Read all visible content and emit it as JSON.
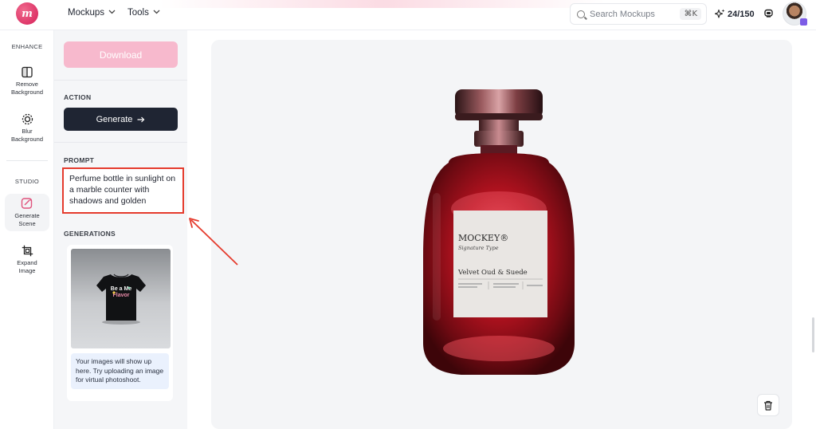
{
  "topbar": {
    "logo_text": "m",
    "menus": [
      {
        "label": "Mockups",
        "icon": "chevron-down-icon"
      },
      {
        "label": "Tools",
        "icon": "chevron-down-icon"
      }
    ],
    "search": {
      "placeholder": "Search Mockups",
      "shortcut": "⌘K"
    },
    "credits": "24/150"
  },
  "rail": {
    "sections": [
      "ENHANCE",
      "STUDIO"
    ],
    "items": [
      {
        "label": "Remove\nBackground",
        "icon": "remove-background-icon",
        "active": false
      },
      {
        "label": "Blur\nBackground",
        "icon": "blur-background-icon",
        "active": false
      },
      {
        "label": "Generate\nScene",
        "icon": "generate-scene-icon",
        "active": true
      },
      {
        "label": "Expand\nImage",
        "icon": "expand-image-icon",
        "active": false
      }
    ]
  },
  "panel": {
    "download_label": "Download",
    "action_label": "ACTION",
    "generate_label": "Generate",
    "prompt_label": "PROMPT",
    "prompt_text": "Perfume bottle in sunlight on a marble counter with shadows and golden",
    "generations_label": "GENERATIONS",
    "generation_shirt_text": "Be a Me\nFlavor",
    "generations_note": "Your images will show up here. Try uploading an image for virtual photoshoot."
  },
  "canvas": {
    "label_brand": "MOCKEY®",
    "label_subtitle": "Signature Type",
    "label_product": "Velvet Oud & Suede"
  },
  "colors": {
    "brand": "#d61f58",
    "download_bg": "#f7b9cd",
    "generate_bg": "#1f2533",
    "highlight": "#e53b2d",
    "note_bg": "#eaf1fd"
  }
}
